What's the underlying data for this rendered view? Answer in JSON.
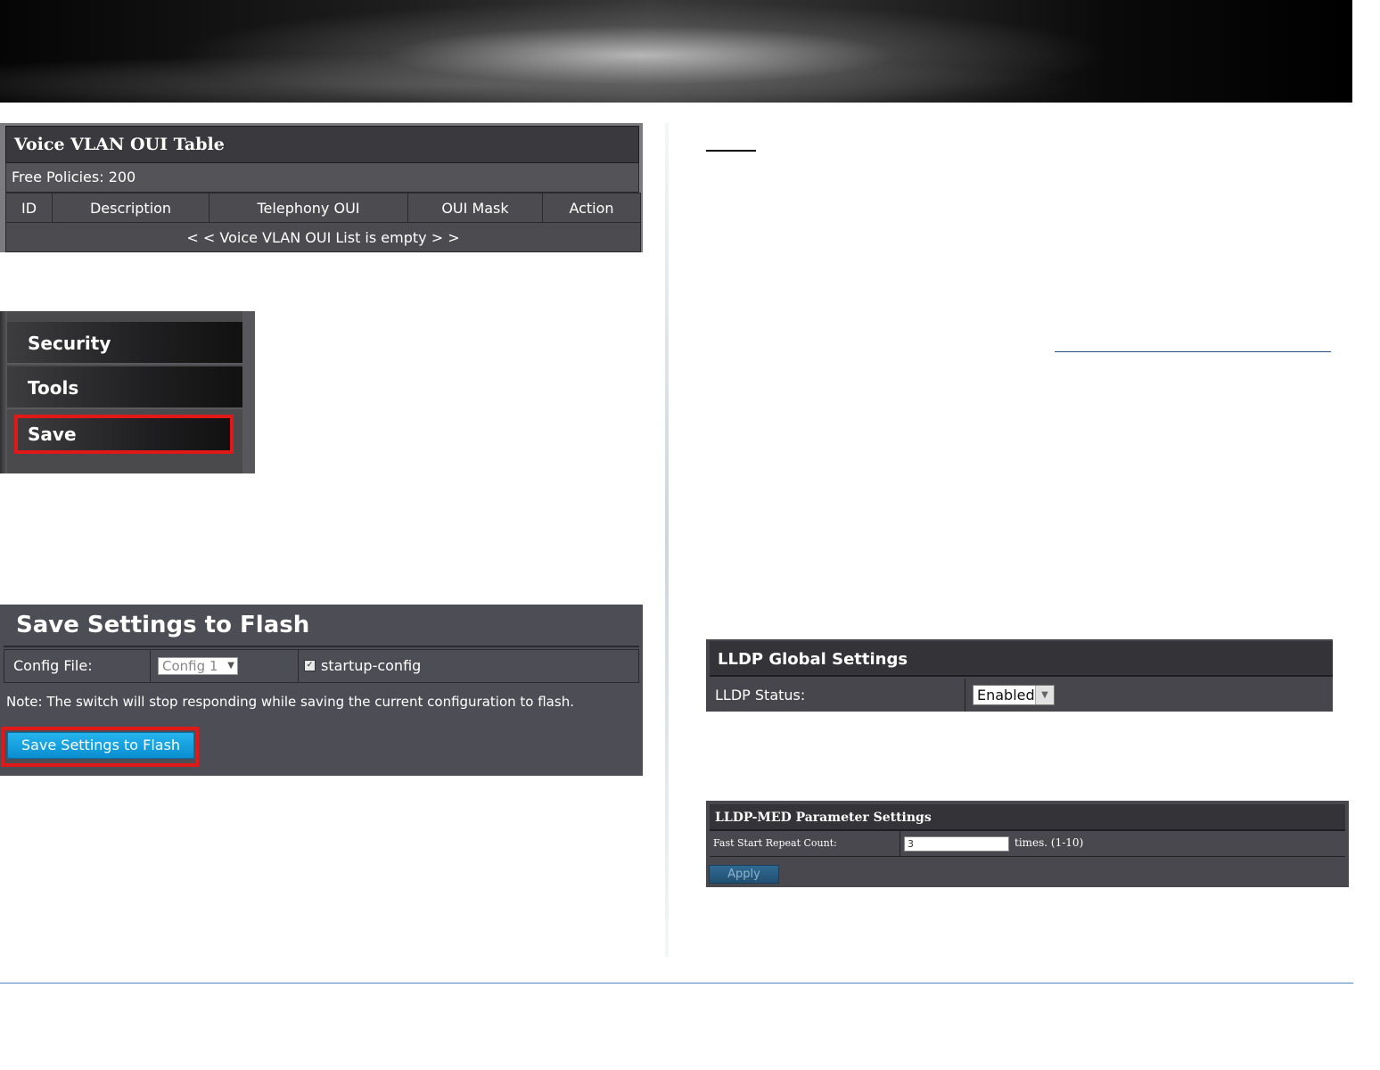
{
  "voice_vlan_oui": {
    "title": "Voice VLAN OUI Table",
    "free_policies": "Free Policies: 200",
    "columns": [
      "ID",
      "Description",
      "Telephony OUI",
      "OUI Mask",
      "Action"
    ],
    "empty_message": "< < Voice VLAN OUI List is empty > >"
  },
  "menu": {
    "items": [
      "Security",
      "Tools",
      "Save"
    ],
    "highlight_color": "#e01818"
  },
  "save_settings": {
    "title": "Save Settings to Flash",
    "config_file_label": "Config File:",
    "config_select_value": "Config 1",
    "startup_config_label": "startup-config",
    "startup_config_checked": true,
    "note": "Note: The switch will stop responding while saving the current configuration to flash.",
    "button_label": "Save Settings to Flash"
  },
  "lldp_global": {
    "title": "LLDP Global Settings",
    "status_label": "LLDP Status:",
    "status_value": "Enabled"
  },
  "lldp_med": {
    "title": "LLDP-MED Parameter Settings",
    "fast_start_label": "Fast Start Repeat Count:",
    "fast_start_value": "3",
    "fast_start_hint": "times. (1-10)",
    "apply_label": "Apply"
  },
  "colors": {
    "accent_blue": "#0a8ed0",
    "footer_line": "#4c86c6"
  }
}
